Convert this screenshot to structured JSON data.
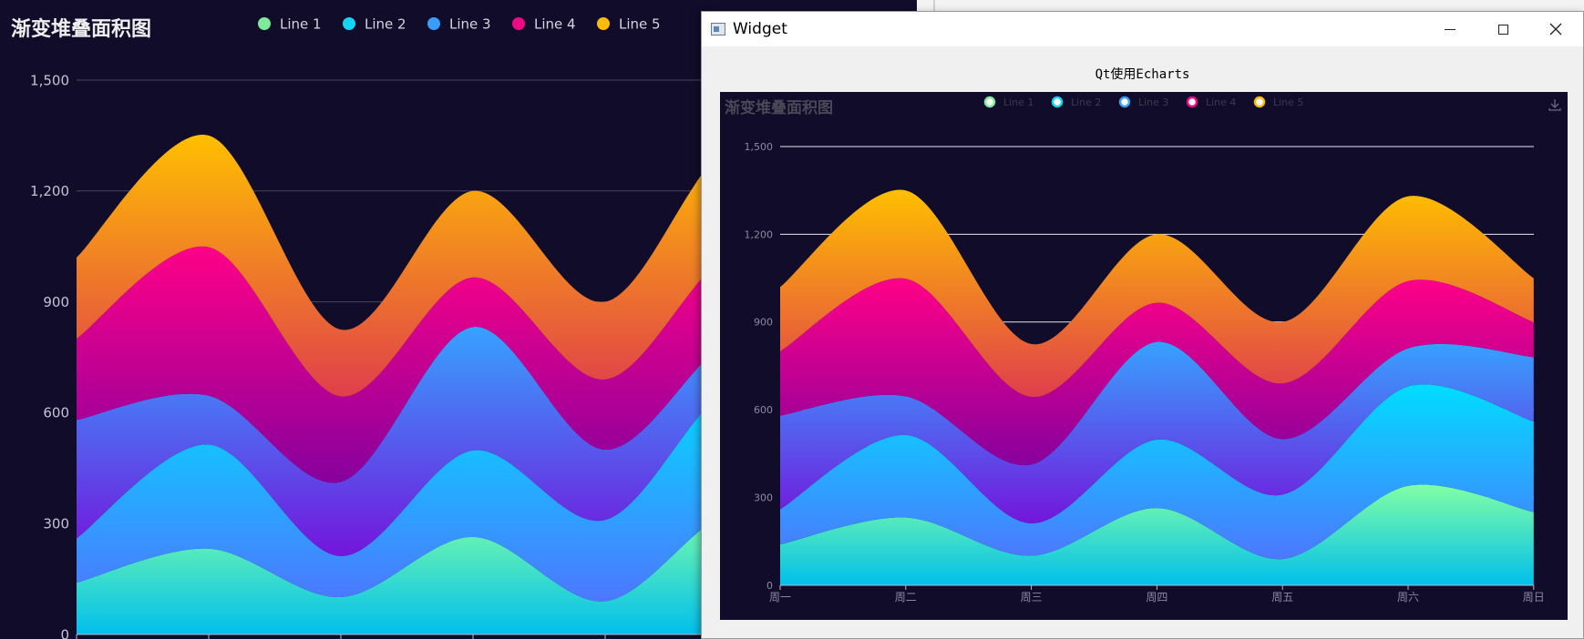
{
  "window": {
    "title": "Widget",
    "label": "Qt使用Echarts"
  },
  "icons": {
    "app": "app-window-icon",
    "minimize": "minimize-icon",
    "maximize": "maximize-icon",
    "close": "close-icon",
    "download": "download-icon"
  },
  "chart_data": [
    {
      "type": "area",
      "stacked": true,
      "smooth": true,
      "title": "渐变堆叠面积图",
      "categories": [
        "周一",
        "周二",
        "周三",
        "周四",
        "周五",
        "周六",
        "周日"
      ],
      "ylim": [
        0,
        1500
      ],
      "yticks": [
        "0",
        "300",
        "600",
        "900",
        "1,200",
        "1,500"
      ],
      "grid": true,
      "legend_position": "top",
      "series": [
        {
          "name": "Line 1",
          "values": [
            140,
            232,
            101,
            264,
            90,
            340,
            250
          ],
          "color_top": "#80ffa5",
          "color_bottom": "#01bfec",
          "legend_color": "#7fe99c"
        },
        {
          "name": "Line 2",
          "values": [
            120,
            282,
            111,
            234,
            220,
            340,
            310
          ],
          "color_top": "#00ddff",
          "color_bottom": "#4d77ff",
          "legend_color": "#16d4f0"
        },
        {
          "name": "Line 3",
          "values": [
            320,
            132,
            201,
            334,
            190,
            130,
            220
          ],
          "color_top": "#37a2ff",
          "color_bottom": "#7415db",
          "legend_color": "#3b9dfa"
        },
        {
          "name": "Line 4",
          "values": [
            220,
            402,
            231,
            134,
            190,
            230,
            120
          ],
          "color_top": "#ff0087",
          "color_bottom": "#87009d",
          "legend_color": "#ee0a83"
        },
        {
          "name": "Line 5",
          "values": [
            220,
            302,
            181,
            234,
            210,
            290,
            150
          ],
          "color_top": "#ffbf00",
          "color_bottom": "#e03e4c",
          "legend_color": "#fbbb0b"
        }
      ]
    }
  ]
}
